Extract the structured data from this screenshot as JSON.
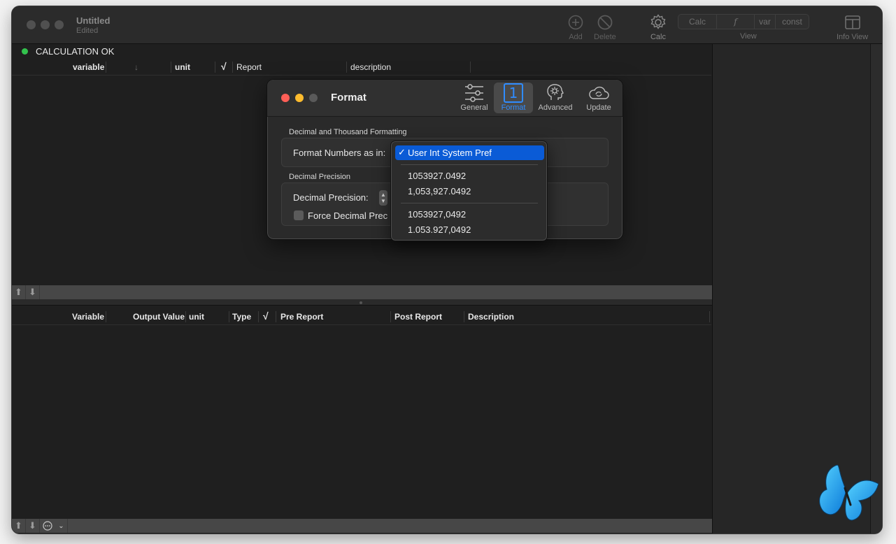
{
  "window": {
    "title": "Untitled",
    "subtitle": "Edited"
  },
  "toolbar": {
    "add_label": "Add",
    "delete_label": "Delete",
    "calc_label": "Calc",
    "view_label": "View",
    "info_view_label": "Info View",
    "segments": [
      "Calc",
      "f",
      "var",
      "const"
    ]
  },
  "status": {
    "text": "CALCULATION OK",
    "color": "#33c24d"
  },
  "input_table": {
    "columns": [
      "variable",
      "↓",
      "unit",
      "√",
      "Report",
      "description"
    ]
  },
  "output_table": {
    "columns": [
      "Variable",
      "Output Value",
      "unit",
      "Type",
      "√",
      "Pre Report",
      "Post Report",
      "Description"
    ]
  },
  "format_dialog": {
    "title": "Format",
    "tabs": [
      "General",
      "Format",
      "Advanced",
      "Update"
    ],
    "active_tab": "Format",
    "format_tab_icon_text": "1",
    "section1_label": "Decimal and Thousand Formatting",
    "format_numbers_label": "Format Numbers as in:",
    "section2_label": "Decimal Precision",
    "decimal_precision_label": "Decimal Precision:",
    "force_label": "Force Decimal Prec"
  },
  "format_menu": {
    "selected": "User Int System Pref",
    "check": "✓",
    "group1": [
      "1053927.0492",
      "1,053,927.0492"
    ],
    "group2": [
      "1053927,0492",
      "1.053.927,0492"
    ]
  },
  "colors": {
    "accent": "#2f8cff",
    "selection": "#0a5bd6",
    "close": "#ff5f57",
    "minimize": "#febc2e"
  }
}
